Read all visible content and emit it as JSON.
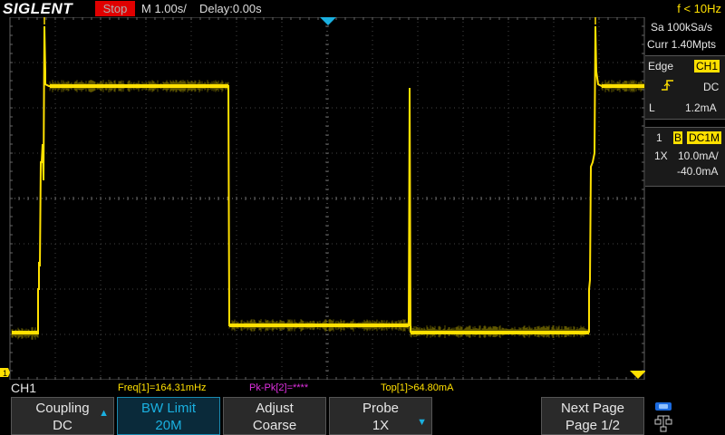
{
  "header": {
    "logo": "SIGLENT",
    "run_status": "Stop",
    "timebase": "M 1.00s/",
    "delay": "Delay:0.00s",
    "trigger_freq": "f < 10Hz"
  },
  "acquisition": {
    "sample_rate": "Sa 100kSa/s",
    "memory_depth": "Curr 1.40Mpts"
  },
  "trigger": {
    "type": "Edge",
    "source": "CH1",
    "coupling": "DC",
    "level_label": "L",
    "level": "1.2mA"
  },
  "channel": {
    "number": "1",
    "bw_marker": "B",
    "coupling": "DC1M",
    "probe": "1X",
    "scale": "10.0mA/",
    "offset": "-40.0mA"
  },
  "measurement_bar": {
    "channel_label": "CH1",
    "freq": "Freq[1]=164.31mHz",
    "pkpk": "Pk-Pk[2]=****",
    "top": "Top[1]>64.80mA"
  },
  "ground_marker": "1",
  "softkeys": [
    {
      "line1": "Coupling",
      "line2": "DC"
    },
    {
      "line1": "BW Limit",
      "line2": "20M"
    },
    {
      "line1": "Adjust",
      "line2": "Coarse"
    },
    {
      "line1": "Probe",
      "line2": "1X"
    },
    {
      "line1": "Next Page",
      "line2": "Page 1/2"
    }
  ],
  "colors": {
    "trace": "#ffe000",
    "stop": "#e00000",
    "active_key": "#1ab0e0",
    "pkpk": "#e030e0",
    "trigger_marker": "#1ab0e0"
  }
}
